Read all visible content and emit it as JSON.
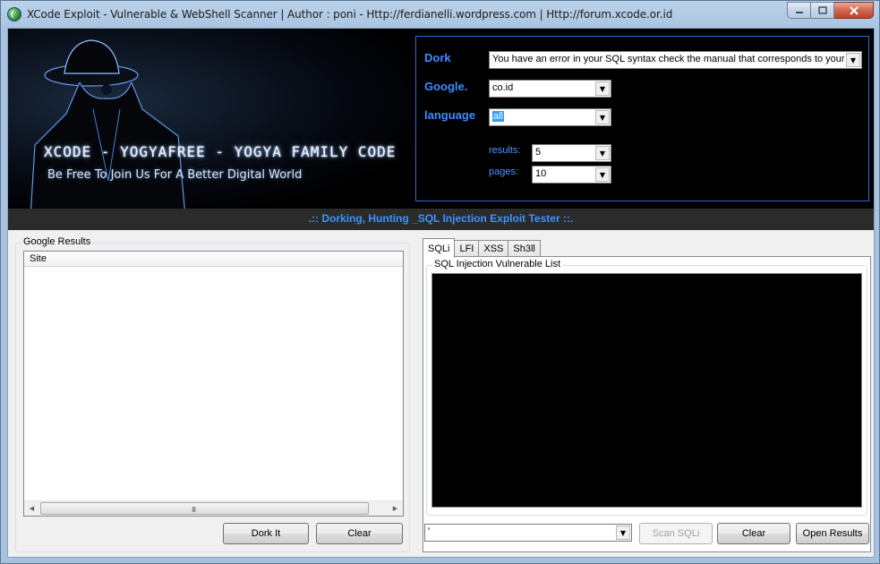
{
  "window": {
    "title": "XCode Exploit - Vulnerable & WebShell Scanner | Author : poni  - Http://ferdianelli.wordpress.com | Http://forum.xcode.or.id"
  },
  "banner": {
    "line1": "XCODE - YOGYAFREE - YOGYA FAMILY CODE",
    "line2": "Be Free To Join Us For A Better Digital World"
  },
  "config": {
    "dork_label": "Dork",
    "dork_value": "You have an error in your SQL syntax check the manual that corresponds to your M",
    "google_label": "Google.",
    "google_value": "co.id",
    "language_label": "language",
    "language_value": "all",
    "results_label": "results:",
    "results_value": "5",
    "pages_label": "pages:",
    "pages_value": "10"
  },
  "subtitle": ".:: Dorking, Hunting _SQL Injection Exploit Tester ::.",
  "google_results": {
    "group_title": "Google Results",
    "column_site": "Site",
    "scroll_grip": "III",
    "dork_button": "Dork It",
    "clear_button": "Clear"
  },
  "tabs": [
    {
      "label": "SQLi"
    },
    {
      "label": "LFI"
    },
    {
      "label": "XSS"
    },
    {
      "label": "Sh3ll"
    }
  ],
  "sqli_panel": {
    "group_title": "SQL Injection Vulnerable List",
    "payload_value": "'",
    "scan_button": "Scan SQLi",
    "clear_button": "Clear",
    "open_button": "Open Results"
  },
  "colors": {
    "accent_blue": "#3c92ff",
    "header_bg": "#000000",
    "subtitle_bar": "#2b2b2b",
    "frame_border": "#2f6bd8"
  }
}
